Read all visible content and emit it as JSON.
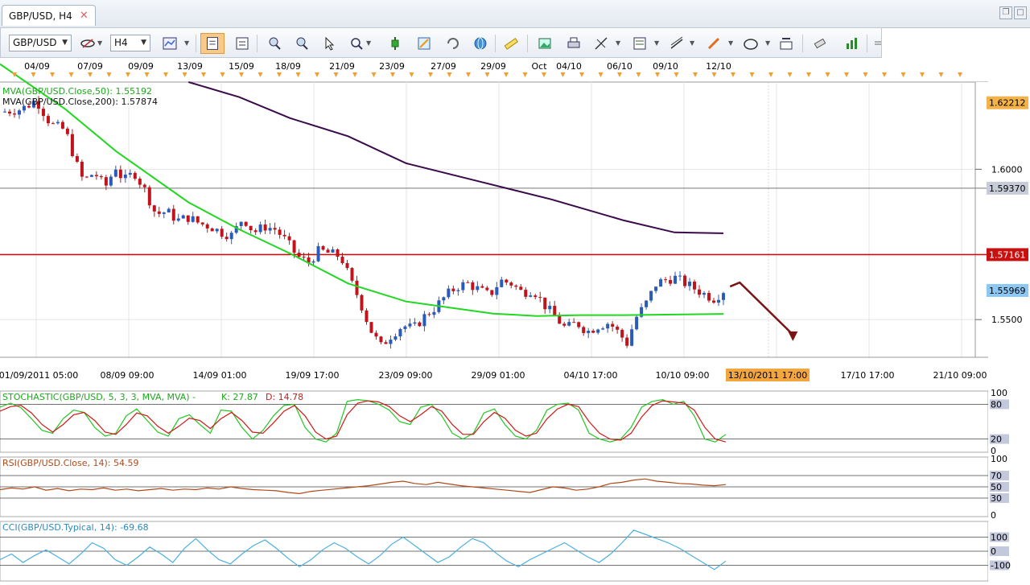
{
  "tab": {
    "title": "GBP/USD, H4",
    "close_glyph": "✕"
  },
  "toolbar": {
    "symbol": "GBP/USD",
    "timeframe": "H4",
    "icons": [
      "chart-type-icon",
      "crosshair-icon",
      "bar-chart-icon",
      "template-icon",
      "zoom-in-icon",
      "zoom-out-icon",
      "pointer-icon",
      "zoom-region-icon",
      "line-tool-icon",
      "pencil-icon",
      "refresh-icon",
      "globe-icon",
      "ruler-icon",
      "screenshot-icon",
      "print-icon",
      "fibonacci-icon",
      "indicator-icon",
      "trendline-icon",
      "brush-icon",
      "ellipse-icon",
      "text-tool-icon",
      "eraser-icon",
      "indicators-list-icon",
      "more-icon"
    ]
  },
  "colors": {
    "bull": "#2a5bb8",
    "bear": "#c0141c",
    "ma50": "#22d722",
    "ma200": "#3a0a4a",
    "resistance": "#e00000",
    "stoch_k": "#22c722",
    "stoch_d": "#d01818",
    "rsi": "#b04a1a",
    "cci": "#4ab0e0",
    "label_ma50": "#1ca81c",
    "date_highlight": "#f2a640"
  },
  "date_axis_top": [
    "04/09",
    "07/09",
    "09/09",
    "13/09",
    "15/09",
    "18/09",
    "21/09",
    "23/09",
    "27/09",
    "29/09",
    "Oct",
    "04/10",
    "06/10",
    "09/10",
    "12/10"
  ],
  "date_axis_bottom": [
    "01/09/2011 05:00",
    "08/09 09:00",
    "14/09 01:00",
    "19/09 17:00",
    "23/09 09:00",
    "29/09 01:00",
    "04/10 17:00",
    "10/10 09:00",
    "13/10/2011 17:00",
    "17/10 17:00",
    "21/10 09:00"
  ],
  "chart_data": [
    {
      "type": "candlestick",
      "title": "GBP/USD, H4",
      "ylim": [
        1.538,
        1.629
      ],
      "price_ticks": [
        1.6,
        1.55
      ],
      "price_labels": [
        {
          "value": 1.62212,
          "text": "1.62212",
          "style": "orange"
        },
        {
          "value": 1.5937,
          "text": "1.59370",
          "style": "grey"
        },
        {
          "value": 1.57161,
          "text": "1.57161",
          "style": "red"
        },
        {
          "value": 1.55969,
          "text": "1.55969",
          "style": "blue"
        }
      ],
      "levels": [
        {
          "value": 1.57161,
          "kind": "resistance"
        },
        {
          "value": 1.5937,
          "kind": "horizontal"
        }
      ],
      "series": [
        {
          "name": "MVA(GBP/USD.Close,50): 1.55192",
          "kind": "ma50",
          "points": [
            [
              0,
              1.635
            ],
            [
              0.09,
              1.62
            ],
            [
              0.16,
              1.606
            ],
            [
              0.26,
              1.589
            ],
            [
              0.33,
              1.58
            ],
            [
              0.4,
              1.572
            ],
            [
              0.48,
              1.562
            ],
            [
              0.56,
              1.556
            ],
            [
              0.62,
              1.554
            ],
            [
              0.68,
              1.552
            ],
            [
              0.74,
              1.5512
            ],
            [
              0.8,
              1.5515
            ],
            [
              0.86,
              1.5515
            ],
            [
              0.9975,
              1.5519
            ]
          ]
        },
        {
          "name": "MVA(GBP/USD.Close,200): 1.57874",
          "kind": "ma200",
          "points": [
            [
              0.26,
              1.629
            ],
            [
              0.33,
              1.624
            ],
            [
              0.4,
              1.617
            ],
            [
              0.48,
              1.611
            ],
            [
              0.56,
              1.602
            ],
            [
              0.66,
              1.596
            ],
            [
              0.76,
              1.59
            ],
            [
              0.86,
              1.583
            ],
            [
              0.93,
              1.579
            ],
            [
              0.9975,
              1.5787
            ]
          ]
        }
      ],
      "close_path": [
        [
          0,
          1.619
        ],
        [
          0.03,
          1.62
        ],
        [
          0.05,
          1.623
        ],
        [
          0.07,
          1.615
        ],
        [
          0.09,
          1.613
        ],
        [
          0.105,
          1.602
        ],
        [
          0.115,
          1.596
        ],
        [
          0.13,
          1.599
        ],
        [
          0.145,
          1.594
        ],
        [
          0.16,
          1.601
        ],
        [
          0.17,
          1.596
        ],
        [
          0.185,
          1.599
        ],
        [
          0.2,
          1.593
        ],
        [
          0.215,
          1.585
        ],
        [
          0.23,
          1.586
        ],
        [
          0.245,
          1.583
        ],
        [
          0.26,
          1.584
        ],
        [
          0.275,
          1.582
        ],
        [
          0.29,
          1.581
        ],
        [
          0.305,
          1.579
        ],
        [
          0.32,
          1.578
        ],
        [
          0.335,
          1.584
        ],
        [
          0.35,
          1.579
        ],
        [
          0.365,
          1.581
        ],
        [
          0.38,
          1.58
        ],
        [
          0.395,
          1.576
        ],
        [
          0.41,
          1.571
        ],
        [
          0.425,
          1.569
        ],
        [
          0.44,
          1.573
        ],
        [
          0.455,
          1.572
        ],
        [
          0.47,
          1.571
        ],
        [
          0.485,
          1.562
        ],
        [
          0.495,
          1.557
        ],
        [
          0.51,
          1.547
        ],
        [
          0.525,
          1.541
        ],
        [
          0.54,
          1.545
        ],
        [
          0.555,
          1.548
        ],
        [
          0.57,
          1.547
        ],
        [
          0.585,
          1.551
        ],
        [
          0.6,
          1.554
        ],
        [
          0.615,
          1.558
        ],
        [
          0.63,
          1.561
        ],
        [
          0.645,
          1.562
        ],
        [
          0.66,
          1.56
        ],
        [
          0.675,
          1.558
        ],
        [
          0.69,
          1.563
        ],
        [
          0.705,
          1.562
        ],
        [
          0.72,
          1.559
        ],
        [
          0.735,
          1.56
        ],
        [
          0.75,
          1.555
        ],
        [
          0.765,
          1.551
        ],
        [
          0.78,
          1.547
        ],
        [
          0.795,
          1.549
        ],
        [
          0.81,
          1.546
        ],
        [
          0.825,
          1.548
        ],
        [
          0.84,
          1.549
        ],
        [
          0.855,
          1.545
        ],
        [
          0.865,
          1.542
        ],
        [
          0.875,
          1.55
        ],
        [
          0.89,
          1.555
        ],
        [
          0.905,
          1.562
        ],
        [
          0.915,
          1.563
        ],
        [
          0.93,
          1.564
        ],
        [
          0.945,
          1.562
        ],
        [
          0.96,
          1.56
        ],
        [
          0.975,
          1.558
        ],
        [
          0.985,
          1.557
        ],
        [
          0.9975,
          1.5597
        ]
      ],
      "forecast_arrow": {
        "from": [
          1.0,
          1.561
        ],
        "to": [
          1.06,
          1.545
        ]
      },
      "current_date_label": "13/10/2011 17:00"
    },
    {
      "type": "line",
      "title": "STOCHASTIC(GBP/USD, 5, 3, 3, MVA, MVA) -",
      "k_label": "K: 27.87",
      "d_label": "D: 14.78",
      "ylim": [
        0,
        100
      ],
      "ticks": [
        100,
        80,
        20,
        0
      ],
      "levels": [
        80,
        20
      ],
      "series": [
        {
          "name": "K",
          "values": [
            75,
            82,
            74,
            55,
            35,
            30,
            55,
            70,
            66,
            40,
            25,
            30,
            60,
            72,
            52,
            32,
            25,
            55,
            62,
            45,
            30,
            70,
            68,
            40,
            20,
            35,
            60,
            78,
            80,
            40,
            20,
            15,
            30,
            85,
            88,
            86,
            80,
            70,
            50,
            45,
            75,
            80,
            60,
            30,
            20,
            30,
            65,
            72,
            45,
            25,
            20,
            35,
            70,
            80,
            82,
            70,
            30,
            20,
            15,
            20,
            40,
            75,
            85,
            88,
            80,
            85,
            60,
            20,
            15,
            28
          ]
        },
        {
          "name": "D",
          "values": [
            68,
            76,
            78,
            65,
            45,
            32,
            45,
            62,
            66,
            52,
            32,
            28,
            45,
            65,
            60,
            42,
            30,
            42,
            56,
            52,
            38,
            55,
            66,
            52,
            32,
            30,
            48,
            68,
            78,
            60,
            32,
            20,
            25,
            62,
            82,
            86,
            84,
            76,
            60,
            50,
            62,
            76,
            68,
            45,
            28,
            28,
            50,
            66,
            56,
            35,
            25,
            30,
            55,
            72,
            80,
            76,
            50,
            30,
            20,
            18,
            30,
            58,
            78,
            86,
            84,
            82,
            70,
            40,
            20,
            15
          ]
        }
      ]
    },
    {
      "type": "line",
      "title": "RSI(GBP/USD.Close, 14): 54.59",
      "ylim": [
        0,
        100
      ],
      "ticks": [
        100,
        70,
        50,
        30,
        0
      ],
      "levels": [
        70,
        50,
        30
      ],
      "series": [
        {
          "name": "RSI",
          "values": [
            45,
            48,
            46,
            50,
            44,
            47,
            43,
            46,
            45,
            48,
            44,
            46,
            43,
            45,
            47,
            44,
            46,
            45,
            48,
            46,
            50,
            47,
            45,
            44,
            43,
            40,
            38,
            42,
            44,
            46,
            48,
            50,
            52,
            55,
            58,
            60,
            56,
            54,
            58,
            55,
            52,
            50,
            48,
            46,
            44,
            42,
            40,
            45,
            50,
            48,
            44,
            46,
            50,
            56,
            58,
            62,
            64,
            60,
            58,
            56,
            55,
            53,
            52,
            54
          ]
        }
      ]
    },
    {
      "type": "line",
      "title": "CCI(GBP/USD.Typical, 14): -69.68",
      "ylim": [
        -200,
        200
      ],
      "ticks": [
        100,
        0,
        -100
      ],
      "levels": [
        100,
        0,
        -100
      ],
      "series": [
        {
          "name": "CCI",
          "values": [
            -60,
            -20,
            -80,
            -30,
            10,
            -40,
            -90,
            -20,
            60,
            20,
            -60,
            -100,
            -40,
            30,
            -20,
            -80,
            20,
            90,
            10,
            -60,
            -90,
            -20,
            40,
            80,
            20,
            -50,
            -110,
            -60,
            10,
            60,
            20,
            -40,
            -90,
            -30,
            50,
            100,
            40,
            -20,
            -80,
            -40,
            30,
            90,
            60,
            -10,
            -70,
            -110,
            -60,
            -20,
            20,
            60,
            10,
            -40,
            -80,
            -20,
            60,
            150,
            120,
            90,
            60,
            20,
            -30,
            -80,
            -130,
            -70
          ]
        }
      ]
    }
  ]
}
